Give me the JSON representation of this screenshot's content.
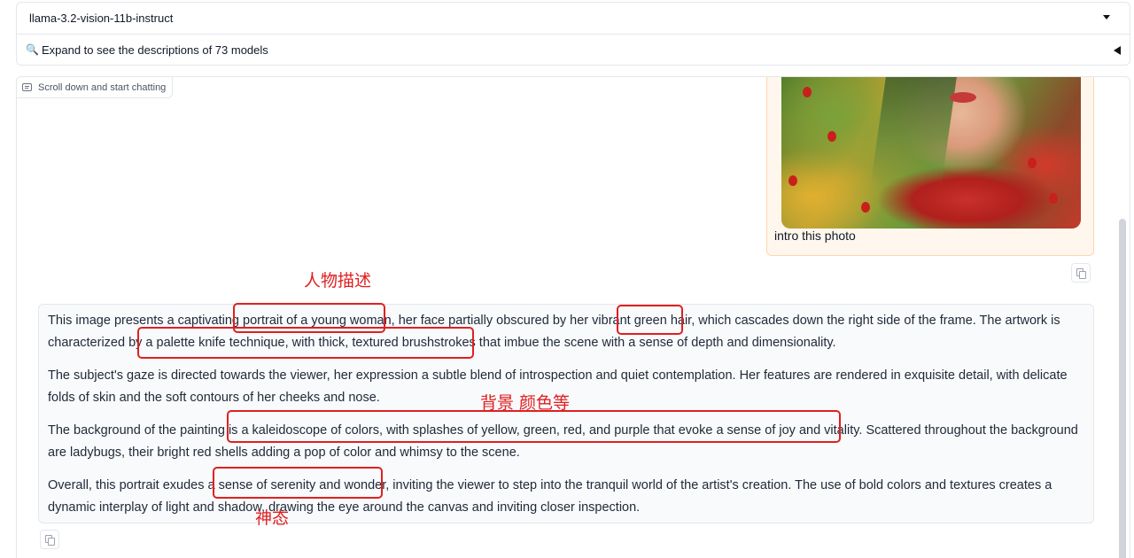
{
  "model_select": {
    "value": "llama-3.2-vision-11b-instruct"
  },
  "models_accordion": {
    "label": "Expand to see the descriptions of 73 models"
  },
  "chatbot": {
    "label": "Scroll down and start chatting",
    "user_message": {
      "caption": "intro this photo"
    },
    "bot_message": {
      "paragraphs": [
        "This image presents a captivating portrait of a young woman, her face partially obscured by her vibrant green hair, which cascades down the right side of the frame. The artwork is characterized by a palette knife technique, with thick, textured brushstrokes that imbue the scene with a sense of depth and dimensionality.",
        "The subject's gaze is directed towards the viewer, her expression a subtle blend of introspection and quiet contemplation. Her features are rendered in exquisite detail, with delicate folds of skin and the soft contours of her cheeks and nose.",
        "The background of the painting is a kaleidoscope of colors, with splashes of yellow, green, red, and purple that evoke a sense of joy and vitality. Scattered throughout the background are ladybugs, their bright red shells adding a pop of color and whimsy to the scene.",
        "Overall, this portrait exudes a sense of serenity and wonder, inviting the viewer to step into the tranquil world of the artist's creation. The use of bold colors and textures creates a dynamic interplay of light and shadow, drawing the eye around the canvas and inviting closer inspection."
      ]
    }
  },
  "annotations": {
    "person": "人物描述",
    "background": "背景 颜色等",
    "mood": "神态"
  },
  "colors": {
    "annotation": "#e02020",
    "user_bubble": "#fff7ed",
    "bot_bubble": "#f8fafc"
  }
}
